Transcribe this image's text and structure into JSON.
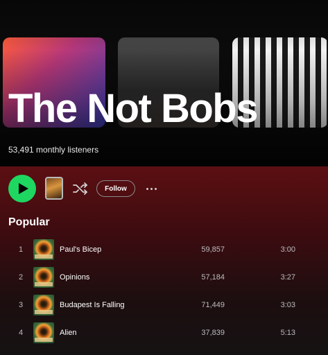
{
  "artist": {
    "name": "The Not Bobs",
    "monthly_listeners": "53,491 monthly listeners"
  },
  "actions": {
    "play_icon": "play-icon",
    "shuffle_icon": "shuffle-icon",
    "follow_label": "Follow",
    "more_icon": "more-options-icon"
  },
  "popular": {
    "title": "Popular",
    "tracks": [
      {
        "number": "1",
        "title": "Paul's Bicep",
        "plays": "59,857",
        "duration": "3:00"
      },
      {
        "number": "2",
        "title": "Opinions",
        "plays": "57,184",
        "duration": "3:27"
      },
      {
        "number": "3",
        "title": "Budapest Is Falling",
        "plays": "71,449",
        "duration": "3:03"
      },
      {
        "number": "4",
        "title": "Alien",
        "plays": "37,839",
        "duration": "5:13"
      }
    ]
  },
  "colors": {
    "play_green": "#1ed760",
    "header_red": "#5c0f12",
    "background": "#121212"
  }
}
